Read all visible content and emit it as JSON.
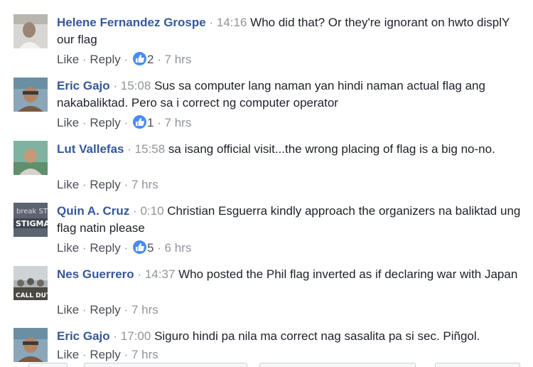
{
  "actions": {
    "like": "Like",
    "reply": "Reply",
    "sep": "·"
  },
  "comments": [
    {
      "author": "Helene Fernandez Grospe",
      "time": "14:16",
      "text": "Who did that? Or they're ignorant on hwto displY our flag",
      "reactions": "2",
      "age": "7 hrs",
      "avatar_icon": "avatar-photo"
    },
    {
      "author": "Eric Gajo",
      "time": "15:08",
      "text": "Sus sa computer lang naman yan hindi naman actual flag ang nakabaliktad. Pero sa i correct ng computer operator",
      "reactions": "1",
      "age": "7 hrs",
      "avatar_icon": "avatar-photo"
    },
    {
      "author": "Lut Vallefas",
      "time": "15:58",
      "text": "sa isang official visit...the wrong placing of flag is a big no-no.",
      "reactions": "",
      "age": "7 hrs",
      "avatar_icon": "avatar-photo"
    },
    {
      "author": "Quin A. Cruz",
      "time": "0:10",
      "text": "Christian Esguerra kindly approach the organizers na baliktad ung flag natin please",
      "reactions": "5",
      "age": "6 hrs",
      "avatar_icon": "avatar-photo"
    },
    {
      "author": "Nes Guerrero",
      "time": "14:37",
      "text": "Who posted the Phil flag inverted as if declaring war with Japan",
      "reactions": "",
      "age": "7 hrs",
      "avatar_icon": "avatar-photo"
    },
    {
      "author": "Eric Gajo",
      "time": "17:00",
      "text": "Siguro hindi pa nila ma correct nag sasalita pa si sec. Piñgol.",
      "reactions": "",
      "age": "7 hrs",
      "avatar_icon": "avatar-photo"
    }
  ],
  "avatar_captions": {
    "quin": "break STIGMA",
    "nes": "CALL DUTY"
  },
  "colors": {
    "author": "#365899",
    "meta": "#90949c",
    "text": "#1d2129",
    "reaction": "#4a8bf5"
  }
}
